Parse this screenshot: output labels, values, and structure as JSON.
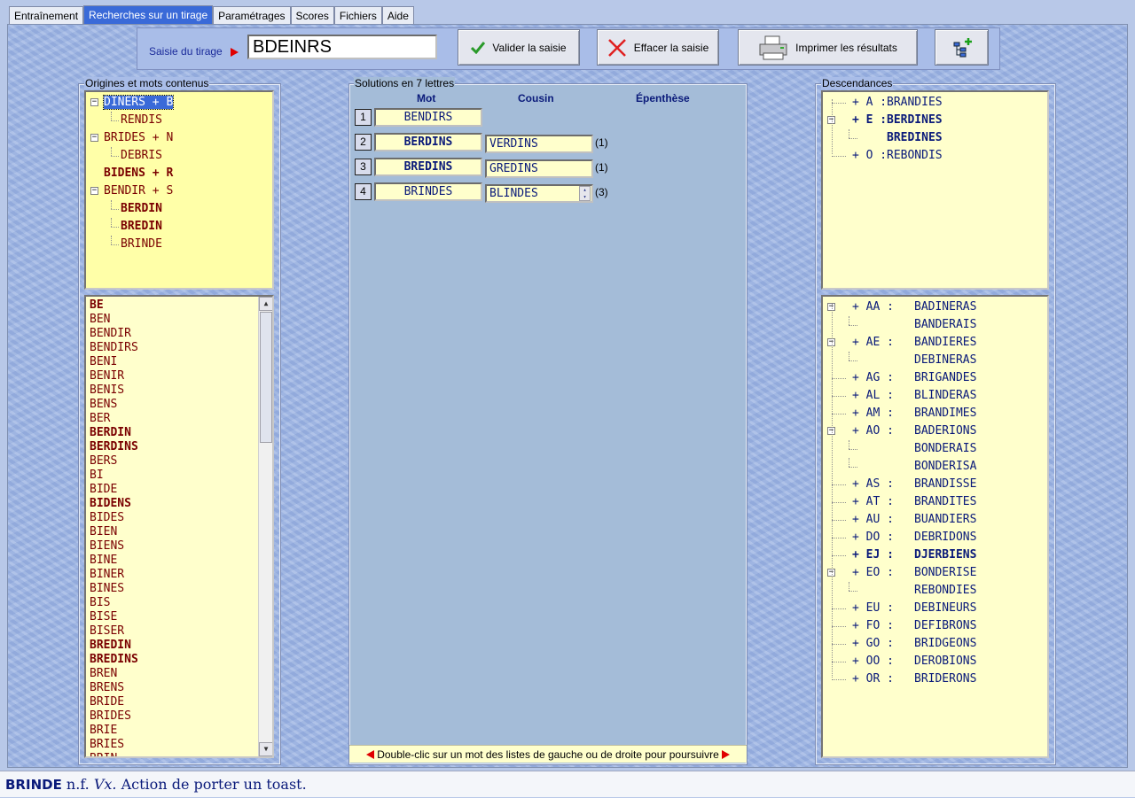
{
  "tabs": [
    {
      "label": "Entraînement",
      "active": false
    },
    {
      "label": "Recherches sur un tirage",
      "active": true
    },
    {
      "label": "Paramétrages",
      "active": false
    },
    {
      "label": "Scores",
      "active": false
    },
    {
      "label": "Fichiers",
      "active": false
    },
    {
      "label": "Aide",
      "active": false
    }
  ],
  "toolbar": {
    "saisie_label": "Saisie du tirage",
    "tirage_value": "BDEINRS",
    "valider_label": "Valider la saisie",
    "effacer_label": "Effacer la saisie",
    "imprimer_label": "Imprimer les résultats",
    "icons": {
      "valider": "checkmark-icon",
      "effacer": "red-x-icon",
      "imprimer": "printer-icon",
      "tree": "tree-add-icon"
    }
  },
  "origines": {
    "title": "Origines et mots contenus",
    "tree": [
      {
        "text": "DINERS + B",
        "level": 0,
        "expanded": true,
        "selected": true,
        "style": "normal"
      },
      {
        "text": "RENDIS",
        "level": 1,
        "style": "normal"
      },
      {
        "text": "BRIDES + N",
        "level": 0,
        "expanded": true,
        "style": "normal"
      },
      {
        "text": "DEBRIS",
        "level": 1,
        "style": "normal"
      },
      {
        "text": "BIDENS + R",
        "level": 0,
        "style": "bold"
      },
      {
        "text": "BENDIR + S",
        "level": 0,
        "expanded": true,
        "style": "normal"
      },
      {
        "text": "BERDIN",
        "level": 1,
        "style": "bold"
      },
      {
        "text": "BREDIN",
        "level": 1,
        "style": "bold"
      },
      {
        "text": "BRINDE",
        "level": 1,
        "style": "normal"
      }
    ],
    "words": [
      {
        "w": "BE",
        "b": true
      },
      {
        "w": "BEN",
        "b": false
      },
      {
        "w": "BENDIR",
        "b": false
      },
      {
        "w": "BENDIRS",
        "b": false
      },
      {
        "w": "BENI",
        "b": false
      },
      {
        "w": "BENIR",
        "b": false
      },
      {
        "w": "BENIS",
        "b": false
      },
      {
        "w": "BENS",
        "b": false
      },
      {
        "w": "BER",
        "b": false
      },
      {
        "w": "BERDIN",
        "b": true
      },
      {
        "w": "BERDINS",
        "b": true
      },
      {
        "w": "BERS",
        "b": false
      },
      {
        "w": "BI",
        "b": false
      },
      {
        "w": "BIDE",
        "b": false
      },
      {
        "w": "BIDENS",
        "b": true
      },
      {
        "w": "BIDES",
        "b": false
      },
      {
        "w": "BIEN",
        "b": false
      },
      {
        "w": "BIENS",
        "b": false
      },
      {
        "w": "BINE",
        "b": false
      },
      {
        "w": "BINER",
        "b": false
      },
      {
        "w": "BINES",
        "b": false
      },
      {
        "w": "BIS",
        "b": false
      },
      {
        "w": "BISE",
        "b": false
      },
      {
        "w": "BISER",
        "b": false
      },
      {
        "w": "BREDIN",
        "b": true
      },
      {
        "w": "BREDINS",
        "b": true
      },
      {
        "w": "BREN",
        "b": false
      },
      {
        "w": "BRENS",
        "b": false
      },
      {
        "w": "BRIDE",
        "b": false
      },
      {
        "w": "BRIDES",
        "b": false
      },
      {
        "w": "BRIE",
        "b": false
      },
      {
        "w": "BRIES",
        "b": false
      },
      {
        "w": "BRIN",
        "b": false
      }
    ]
  },
  "solutions": {
    "title": "Solutions en 7 lettres",
    "col_mot": "Mot",
    "col_cousin": "Cousin",
    "col_epenthese": "Épenthèse",
    "rows": [
      {
        "n": "1",
        "mot": "BENDIRS",
        "bold": false,
        "cousin": "",
        "count": ""
      },
      {
        "n": "2",
        "mot": "BERDINS",
        "bold": true,
        "cousin": "VERDINS",
        "count": "(1)"
      },
      {
        "n": "3",
        "mot": "BREDINS",
        "bold": true,
        "cousin": "GREDINS",
        "count": "(1)"
      },
      {
        "n": "4",
        "mot": "BRINDES",
        "bold": false,
        "cousin": "BLINDES",
        "count": "(3)",
        "spinner": true
      }
    ],
    "hint": "Double-clic sur un mot des listes de gauche ou de droite pour poursuivre"
  },
  "descendances": {
    "title": "Descendances",
    "top": [
      {
        "prefix": "+ A :",
        "word": "BRANDIES",
        "bold": false,
        "expander": false
      },
      {
        "prefix": "+ E :",
        "word": "BERDINES",
        "bold": true,
        "expander": true
      },
      {
        "prefix": "",
        "word": "BREDINES",
        "bold": true,
        "expander": false,
        "child": true
      },
      {
        "prefix": "+ O :",
        "word": "REBONDIS",
        "bold": false,
        "expander": false
      }
    ],
    "bottom": [
      {
        "prefix": "+ AA :",
        "word": "BADINERAS",
        "bold": false,
        "expander": true
      },
      {
        "prefix": "",
        "word": "BANDERAIS",
        "bold": false,
        "child": true
      },
      {
        "prefix": "+ AE :",
        "word": "BANDIERES",
        "bold": false,
        "expander": true
      },
      {
        "prefix": "",
        "word": "DEBINERAS",
        "bold": false,
        "child": true
      },
      {
        "prefix": "+ AG :",
        "word": "BRIGANDES",
        "bold": false
      },
      {
        "prefix": "+ AL :",
        "word": "BLINDERAS",
        "bold": false
      },
      {
        "prefix": "+ AM :",
        "word": "BRANDIMES",
        "bold": false
      },
      {
        "prefix": "+ AO :",
        "word": "BADERIONS",
        "bold": false,
        "expander": true
      },
      {
        "prefix": "",
        "word": "BONDERAIS",
        "bold": false,
        "child": true
      },
      {
        "prefix": "",
        "word": "BONDERISA",
        "bold": false,
        "child": true
      },
      {
        "prefix": "+ AS :",
        "word": "BRANDISSE",
        "bold": false
      },
      {
        "prefix": "+ AT :",
        "word": "BRANDITES",
        "bold": false
      },
      {
        "prefix": "+ AU :",
        "word": "BUANDIERS",
        "bold": false
      },
      {
        "prefix": "+ DO :",
        "word": "DEBRIDONS",
        "bold": false
      },
      {
        "prefix": "+ EJ :",
        "word": "DJERBIENS",
        "bold": true
      },
      {
        "prefix": "+ EO :",
        "word": "BONDERISE",
        "bold": false,
        "expander": true
      },
      {
        "prefix": "",
        "word": "REBONDIES",
        "bold": false,
        "child": true
      },
      {
        "prefix": "+ EU :",
        "word": "DEBINEURS",
        "bold": false
      },
      {
        "prefix": "+ FO :",
        "word": "DEFIBRONS",
        "bold": false
      },
      {
        "prefix": "+ GO :",
        "word": "BRIDGEONS",
        "bold": false
      },
      {
        "prefix": "+ OO :",
        "word": "DEROBIONS",
        "bold": false
      },
      {
        "prefix": "+ OR :",
        "word": "BRIDERONS",
        "bold": false
      }
    ]
  },
  "status": {
    "word": "BRINDE",
    "category": "n.f.",
    "register": "Vx.",
    "definition": "Action de porter un toast."
  }
}
